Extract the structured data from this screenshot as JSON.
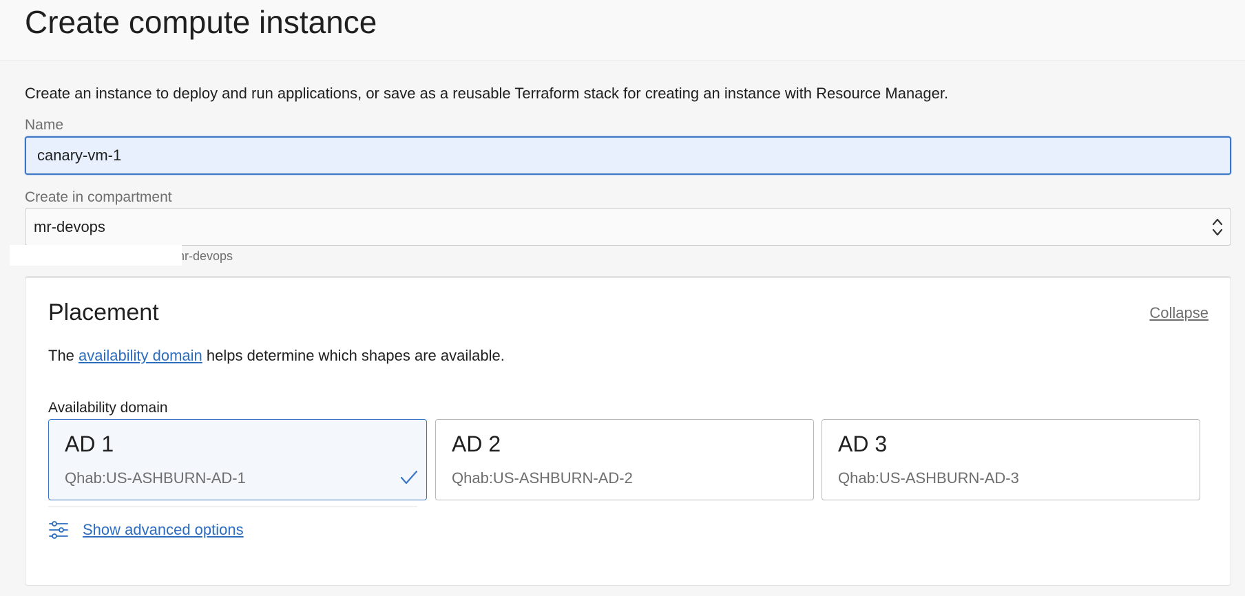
{
  "header": {
    "title": "Create compute instance"
  },
  "intro": {
    "text": "Create an instance to deploy and run applications, or save as a reusable Terraform stack for creating an instance with Resource Manager."
  },
  "name_field": {
    "label": "Name",
    "value": "canary-vm-1"
  },
  "compartment_field": {
    "label": "Create in compartment",
    "value": "mr-devops",
    "breadcrumb_visible": "nr-devops"
  },
  "placement": {
    "title": "Placement",
    "collapse_label": "Collapse",
    "desc_prefix": "The ",
    "desc_link": "availability domain",
    "desc_suffix": " helps determine which shapes are available.",
    "ad_label": "Availability domain",
    "domains": [
      {
        "title": "AD 1",
        "subtitle": "Qhab:US-ASHBURN-AD-1",
        "selected": true
      },
      {
        "title": "AD 2",
        "subtitle": "Qhab:US-ASHBURN-AD-2",
        "selected": false
      },
      {
        "title": "AD 3",
        "subtitle": "Qhab:US-ASHBURN-AD-3",
        "selected": false
      }
    ],
    "advanced_label": "Show advanced options",
    "advanced_icon": "sliders-icon"
  },
  "colors": {
    "accent": "#3a76c4",
    "link": "#2b6cbf",
    "selected_bg": "#f4f8fd",
    "input_bg": "#e8f0fd",
    "muted_text": "#6e6e6e"
  }
}
